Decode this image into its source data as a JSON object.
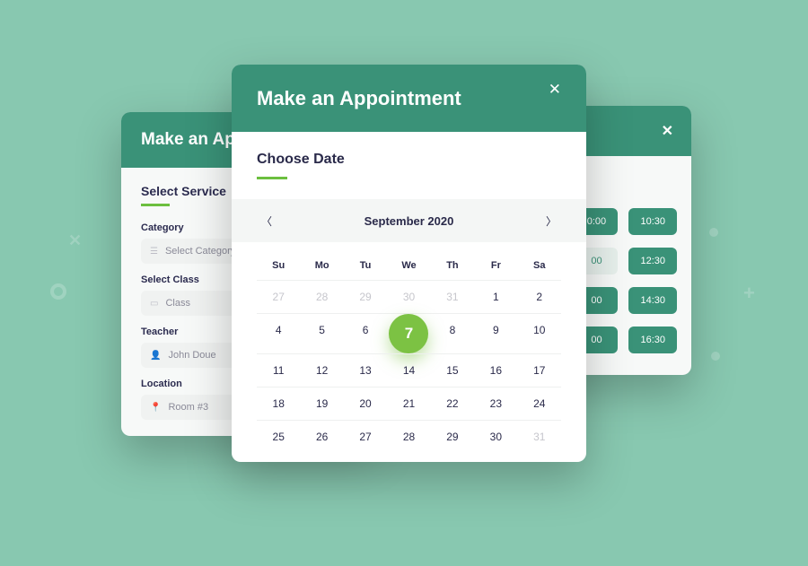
{
  "decorations": {},
  "leftCard": {
    "title": "Make an Appointment",
    "sectionTitle": "Select Service",
    "fields": {
      "categoryLabel": "Category",
      "categoryValue": "Select Category",
      "classLabel": "Select Class",
      "classValue": "Class",
      "teacherLabel": "Teacher",
      "teacherValue": "John Doue",
      "locationLabel": "Location",
      "locationValue": "Room #3"
    }
  },
  "rightCard": {
    "title": "ment",
    "times": [
      [
        "0:00",
        "10:30"
      ],
      [
        "00",
        "12:30"
      ],
      [
        "00",
        "14:30"
      ],
      [
        "00",
        "16:30"
      ]
    ]
  },
  "centerCard": {
    "title": "Make an Appointment",
    "sectionTitle": "Choose Date",
    "monthLabel": "September 2020",
    "weekdays": [
      "Su",
      "Mo",
      "Tu",
      "We",
      "Th",
      "Fr",
      "Sa"
    ],
    "rows": [
      [
        {
          "v": "27",
          "out": true
        },
        {
          "v": "28",
          "out": true
        },
        {
          "v": "29",
          "out": true
        },
        {
          "v": "30",
          "out": true
        },
        {
          "v": "31",
          "out": true
        },
        {
          "v": "1"
        },
        {
          "v": "2"
        }
      ],
      [
        {
          "v": "4"
        },
        {
          "v": "5"
        },
        {
          "v": "6"
        },
        {
          "v": "7",
          "sel": true
        },
        {
          "v": "8"
        },
        {
          "v": "9"
        },
        {
          "v": "10"
        }
      ],
      [
        {
          "v": "11"
        },
        {
          "v": "12"
        },
        {
          "v": "13"
        },
        {
          "v": "14"
        },
        {
          "v": "15"
        },
        {
          "v": "16"
        },
        {
          "v": "17"
        }
      ],
      [
        {
          "v": "18"
        },
        {
          "v": "19"
        },
        {
          "v": "20"
        },
        {
          "v": "21"
        },
        {
          "v": "22"
        },
        {
          "v": "23"
        },
        {
          "v": "24"
        }
      ],
      [
        {
          "v": "25"
        },
        {
          "v": "26"
        },
        {
          "v": "27"
        },
        {
          "v": "28"
        },
        {
          "v": "29"
        },
        {
          "v": "30"
        },
        {
          "v": "31",
          "out": true
        }
      ]
    ]
  }
}
